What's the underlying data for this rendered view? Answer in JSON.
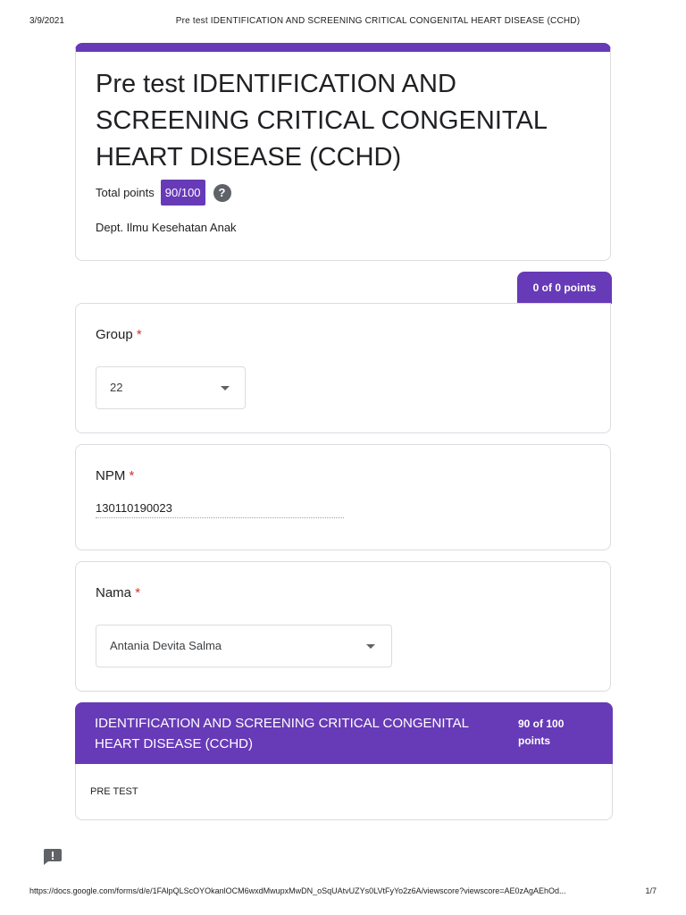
{
  "header": {
    "date": "3/9/2021",
    "page_title": "Pre test IDENTIFICATION AND SCREENING CRITICAL CONGENITAL HEART DISEASE (CCHD)"
  },
  "form": {
    "title": "Pre test IDENTIFICATION AND SCREENING CRITICAL CONGENITAL HEART DISEASE (CCHD)",
    "total_points_label": "Total points",
    "score": "90/100",
    "help_symbol": "?",
    "description": "Dept. Ilmu Kesehatan Anak"
  },
  "section_zero": {
    "points": "0 of 0 points"
  },
  "questions": [
    {
      "label": "Group",
      "required_mark": "*",
      "answer": "22"
    },
    {
      "label": "NPM",
      "required_mark": "*",
      "answer": "130110190023"
    },
    {
      "label": "Nama",
      "required_mark": "*",
      "answer": "Antania Devita Salma"
    }
  ],
  "section": {
    "title": "IDENTIFICATION AND SCREENING CRITICAL CONGENITAL HEART DISEASE (CCHD)",
    "points": "90 of 100 points",
    "description": "PRE TEST"
  },
  "footer": {
    "url": "https://docs.google.com/forms/d/e/1FAlpQLScOYOkanlOCM6wxdMwupxMwDN_oSqUAtvUZYs0LVtFyYo2z6A/viewscore?viewscore=AE0zAgAEhOd...",
    "page_number": "1/7"
  },
  "colors": {
    "accent": "#673ab7",
    "required": "#d93025",
    "border": "#dadce0"
  },
  "icons": {
    "help": "help-circle-icon",
    "feedback": "feedback-icon",
    "dropdown": "caret-down-icon"
  }
}
